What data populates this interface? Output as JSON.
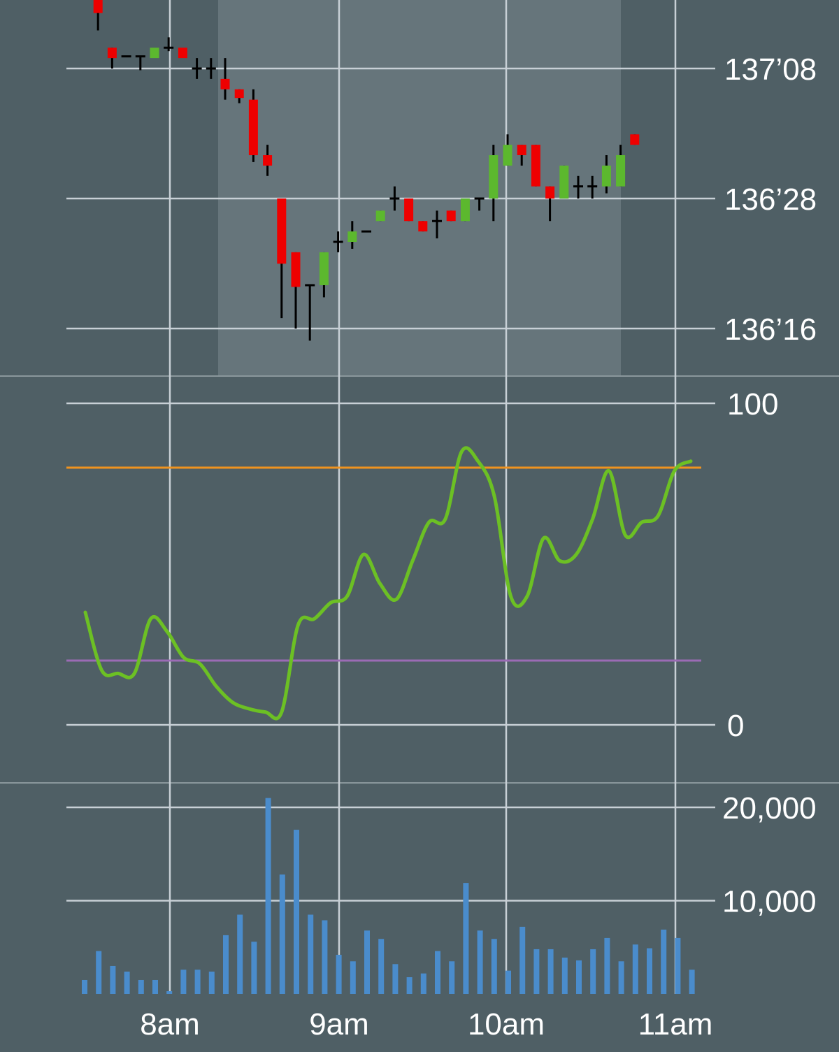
{
  "colors": {
    "background": "#4f5f65",
    "session_shade": "#66757b",
    "grid": "#c8d0d6",
    "panel_divider": "#8a979c",
    "bull": "#5cb82e",
    "bear": "#ee0000",
    "wick": "#000000",
    "oscillator": "#6cc024",
    "overbought": "#f0931e",
    "oversold": "#9b6bb5",
    "volume": "#4a8ccc",
    "text": "#ffffff"
  },
  "chart_data": [
    {
      "type": "candlestick",
      "price_unit_note": "prices in 32nds",
      "yticks": [
        136.5,
        136.875,
        137.25
      ],
      "ytick_labels": [
        "136’16",
        "136’28",
        "137’08"
      ],
      "ylim": [
        136.4,
        137.555
      ],
      "xlim": [
        0,
        40
      ],
      "session_shade": [
        8,
        32
      ],
      "grid": true,
      "candles": [
        {
          "o": 137.556,
          "h": 137.6,
          "l": 137.52,
          "c": 137.52
        },
        {
          "o": 137.52,
          "h": 137.52,
          "l": 137.36,
          "c": 137.41
        },
        {
          "o": 137.31,
          "h": 137.31,
          "l": 137.25,
          "c": 137.28
        },
        {
          "o": 137.285,
          "h": 137.285,
          "l": 137.285,
          "c": 137.285
        },
        {
          "o": 137.285,
          "h": 137.285,
          "l": 137.245,
          "c": 137.285
        },
        {
          "o": 137.28,
          "h": 137.28,
          "l": 137.28,
          "c": 137.31
        },
        {
          "o": 137.31,
          "h": 137.34,
          "l": 137.3,
          "c": 137.31
        },
        {
          "o": 137.31,
          "h": 137.28,
          "l": 137.28,
          "c": 137.28
        },
        {
          "o": 137.25,
          "h": 137.28,
          "l": 137.22,
          "c": 137.25
        },
        {
          "o": 137.25,
          "h": 137.28,
          "l": 137.22,
          "c": 137.25
        },
        {
          "o": 137.22,
          "h": 137.28,
          "l": 137.16,
          "c": 137.19
        },
        {
          "o": 137.19,
          "h": 137.19,
          "l": 137.15,
          "c": 137.165
        },
        {
          "o": 137.16,
          "h": 137.19,
          "l": 136.98,
          "c": 137.0
        },
        {
          "o": 137.0,
          "h": 137.03,
          "l": 136.94,
          "c": 136.97
        },
        {
          "o": 136.875,
          "h": 136.875,
          "l": 136.53,
          "c": 136.687
        },
        {
          "o": 136.72,
          "h": 136.72,
          "l": 136.5,
          "c": 136.62
        },
        {
          "o": 136.625,
          "h": 136.625,
          "l": 136.465,
          "c": 136.625
        },
        {
          "o": 136.625,
          "h": 136.72,
          "l": 136.59,
          "c": 136.72
        },
        {
          "o": 136.75,
          "h": 136.78,
          "l": 136.72,
          "c": 136.75
        },
        {
          "o": 136.75,
          "h": 136.81,
          "l": 136.73,
          "c": 136.78
        },
        {
          "o": 136.78,
          "h": 136.78,
          "l": 136.78,
          "c": 136.78
        },
        {
          "o": 136.81,
          "h": 136.84,
          "l": 136.81,
          "c": 136.84
        },
        {
          "o": 136.875,
          "h": 136.91,
          "l": 136.84,
          "c": 136.875
        },
        {
          "o": 136.875,
          "h": 136.875,
          "l": 136.81,
          "c": 136.81
        },
        {
          "o": 136.81,
          "h": 136.81,
          "l": 136.78,
          "c": 136.78
        },
        {
          "o": 136.81,
          "h": 136.84,
          "l": 136.76,
          "c": 136.81
        },
        {
          "o": 136.84,
          "h": 136.84,
          "l": 136.81,
          "c": 136.81
        },
        {
          "o": 136.81,
          "h": 136.875,
          "l": 136.81,
          "c": 136.875
        },
        {
          "o": 136.875,
          "h": 136.875,
          "l": 136.84,
          "c": 136.875
        },
        {
          "o": 136.875,
          "h": 137.03,
          "l": 136.81,
          "c": 137.0
        },
        {
          "o": 136.97,
          "h": 137.06,
          "l": 136.97,
          "c": 137.03
        },
        {
          "o": 137.03,
          "h": 137.03,
          "l": 136.97,
          "c": 137.0
        },
        {
          "o": 137.03,
          "h": 137.03,
          "l": 136.91,
          "c": 136.91
        },
        {
          "o": 136.91,
          "h": 136.91,
          "l": 136.81,
          "c": 136.875
        },
        {
          "o": 136.875,
          "h": 136.97,
          "l": 136.875,
          "c": 136.97
        },
        {
          "o": 136.91,
          "h": 136.94,
          "l": 136.875,
          "c": 136.91
        },
        {
          "o": 136.91,
          "h": 136.94,
          "l": 136.875,
          "c": 136.91
        },
        {
          "o": 136.91,
          "h": 137.0,
          "l": 136.89,
          "c": 136.97
        },
        {
          "o": 136.91,
          "h": 137.03,
          "l": 136.91,
          "c": 137.0
        },
        {
          "o": 137.06,
          "h": 137.06,
          "l": 137.03,
          "c": 137.03
        }
      ]
    },
    {
      "type": "line",
      "ylim": [
        0,
        100
      ],
      "yticks": [
        0,
        100
      ],
      "ytick_labels": [
        "0",
        "100"
      ],
      "levels": {
        "overbought": 80,
        "oversold": 20
      },
      "values": [
        35,
        17,
        16,
        16,
        33,
        29,
        21,
        19,
        12,
        7,
        5,
        4,
        4,
        31,
        33,
        38,
        40,
        53,
        44,
        39,
        51,
        63,
        64,
        85,
        82,
        71,
        40,
        40,
        58,
        51,
        53,
        64,
        79,
        59,
        63,
        65,
        79,
        82
      ]
    },
    {
      "type": "bar",
      "ylim": [
        0,
        21000
      ],
      "yticks": [
        10000,
        20000
      ],
      "ytick_labels": [
        "10,000",
        "20,000"
      ],
      "values": [
        1500,
        4600,
        3000,
        2400,
        1500,
        1500,
        300,
        2600,
        2600,
        2400,
        6300,
        8500,
        5600,
        21000,
        12800,
        17600,
        8500,
        7900,
        4200,
        3500,
        6800,
        5900,
        3200,
        1800,
        2200,
        4600,
        3500,
        11900,
        6800,
        5900,
        2500,
        7200,
        4800,
        4800,
        3900,
        3600,
        4800,
        6000,
        3500,
        5300,
        4900,
        6900,
        6000,
        2600
      ]
    }
  ],
  "time_axis": {
    "labels": [
      "8am",
      "9am",
      "10am",
      "11am"
    ]
  }
}
